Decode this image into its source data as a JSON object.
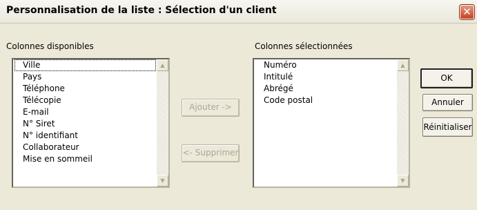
{
  "window": {
    "title": "Personnalisation de la liste : Sélection d'un client",
    "close_glyph": "✕"
  },
  "available": {
    "label": "Colonnes disponibles",
    "items": [
      "Ville",
      "Pays",
      "Téléphone",
      "Télécopie",
      "E-mail",
      "N° Siret",
      "N° identifiant",
      "Collaborateur",
      "Mise en sommeil"
    ],
    "focused_index": 0
  },
  "selected": {
    "label": "Colonnes sélectionnées",
    "items": [
      "Numéro",
      "Intitulé",
      "Abrégé",
      "Code postal"
    ]
  },
  "buttons": {
    "add": "Ajouter ->",
    "remove": "<- Supprimer",
    "ok": "OK",
    "cancel": "Annuler",
    "reset": "Réinitialiser"
  },
  "scroll": {
    "up_glyph": "▲",
    "down_glyph": "▼"
  },
  "colors": {
    "face": "#ece9d8",
    "close": "#c4431d",
    "disabled_text": "#aaa69a"
  }
}
